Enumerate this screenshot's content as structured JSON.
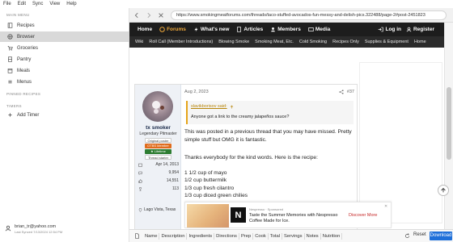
{
  "menubar": [
    "File",
    "Edit",
    "Sync",
    "View",
    "Help"
  ],
  "sidebar": {
    "main_menu_label": "MAIN MENU",
    "items": [
      {
        "label": "Recipes",
        "icon": "book-icon"
      },
      {
        "label": "Browser",
        "icon": "globe-icon"
      },
      {
        "label": "Groceries",
        "icon": "cart-icon"
      },
      {
        "label": "Pantry",
        "icon": "pantry-icon"
      },
      {
        "label": "Meals",
        "icon": "calendar-icon"
      },
      {
        "label": "Menus",
        "icon": "menu-icon"
      }
    ],
    "pinned_label": "PINNED RECIPES",
    "timers_label": "TIMERS",
    "add_timer": "Add Timer",
    "account_email": "brian_tr@yahoo.com",
    "last_synced": "Last Synced 7/13/2024 12:54 PM"
  },
  "browser": {
    "url": "https://www.smokingmeatforums.com/threads/taco-stuffed-avocados-fun-messy-and-delish-pics.322488/page-2#post-2451823"
  },
  "site_nav": {
    "items": [
      "Home",
      "Forums",
      "What's new",
      "Articles",
      "Members",
      "Media"
    ],
    "login": "Log in",
    "register": "Register",
    "sub_items": [
      "Wiki",
      "Roll Call (Member Introductions)",
      "Blowing Smoke",
      "Smoking Meat, Etc.",
      "Cold Smoking",
      "Recipes Only",
      "Supplies & Equipment",
      "Home"
    ]
  },
  "post": {
    "date": "Aug 2, 2023",
    "number": "#37",
    "username": "tx smoker",
    "user_title": "Legendary Pitmaster",
    "badges": [
      "Original poster",
      "OTBS Member",
      "★ Lifetime Premier ★",
      "Thread starter"
    ],
    "stats": [
      {
        "icon": "calendar-icon",
        "value": "Apr 14, 2013"
      },
      {
        "icon": "messages-icon",
        "value": "9,954"
      },
      {
        "icon": "thumbs-up-icon",
        "value": "14,551"
      },
      {
        "icon": "trophy-icon",
        "value": "113"
      }
    ],
    "location": "Lago Vista, Texas",
    "quote_author": "slavikborisov said:",
    "quote_text": "Anyone got a link to the creamy jalapeños sauce?",
    "para1": "This was posted in a previous thread that you may have missed. Pretty simple stuff but OMG it is fantastic.",
    "para2": "Thanks everybody for the kind words. Here is the recipe:",
    "recipe_lines": [
      "1 1/2 cup of mayo",
      "1/2 cup buttermilk",
      "1/3 cup fresh cilantro",
      "1/3 cup diced green chilies"
    ]
  },
  "ad": {
    "brand": "Nespresso · Sponsored",
    "headline": "Taste the Summer Memories with Nespresso Coffee Made for Ice.",
    "cta": "Discover More",
    "logo_letter": "N"
  },
  "colbar": {
    "chips": [
      "Name",
      "Description",
      "Ingredients",
      "Directions",
      "Prep",
      "Cook",
      "Total",
      "Servings",
      "Notes",
      "Nutrition"
    ],
    "reset": "Reset",
    "download": "Download"
  },
  "colors": {
    "nav_bg": "#1d1d1d",
    "accent": "#f0a93b",
    "download": "#1e6fd9",
    "sidebar_active": "#d9d9d9"
  }
}
